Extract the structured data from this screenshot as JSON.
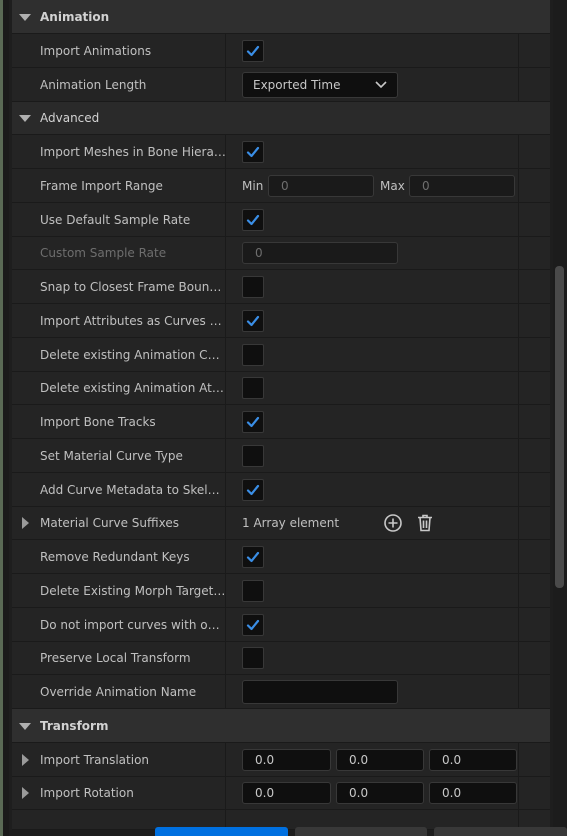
{
  "sections": {
    "animation": "Animation",
    "advanced": "Advanced",
    "transform": "Transform"
  },
  "rows": {
    "import_animations": "Import Animations",
    "animation_length": "Animation Length",
    "animation_length_value": "Exported Time",
    "import_meshes_bone": "Import Meshes in Bone Hierar...",
    "frame_import_range": "Frame Import Range",
    "min_label": "Min",
    "min_value": "0",
    "max_label": "Max",
    "max_value": "0",
    "use_default_sample_rate": "Use Default Sample Rate",
    "custom_sample_rate": "Custom Sample Rate",
    "custom_sample_rate_value": "0",
    "snap_closest_frame": "Snap to Closest Frame Boundary",
    "import_attributes_curves": "Import Attributes as Curves or...",
    "delete_existing_anim_curves": "Delete existing Animation Curv...",
    "delete_existing_anim_attrs": "Delete existing Animation Attri...",
    "import_bone_tracks": "Import Bone Tracks",
    "set_material_curve_type": "Set Material Curve Type",
    "add_curve_metadata": "Add Curve Metadata to Skeleton",
    "material_curve_suffixes": "Material Curve Suffixes",
    "material_curve_suffixes_value": "1 Array element",
    "remove_redundant_keys": "Remove Redundant Keys",
    "delete_existing_morph": "Delete Existing Morph Target C...",
    "do_not_import_curves": "Do not import curves with only...",
    "preserve_local_transform": "Preserve Local Transform",
    "override_animation_name": "Override Animation Name",
    "override_animation_name_value": "",
    "import_translation": "Import Translation",
    "import_translation_values": [
      "0.0",
      "0.0",
      "0.0"
    ],
    "import_rotation": "Import Rotation",
    "import_rotation_values": [
      "0.0",
      "0.0",
      "0.0"
    ]
  },
  "checked": {
    "import_animations": true,
    "import_meshes_bone": true,
    "use_default_sample_rate": true,
    "snap_closest_frame": false,
    "import_attributes_curves": true,
    "delete_existing_anim_curves": false,
    "delete_existing_anim_attrs": false,
    "import_bone_tracks": true,
    "set_material_curve_type": false,
    "add_curve_metadata": true,
    "remove_redundant_keys": true,
    "delete_existing_morph": false,
    "do_not_import_curves": true,
    "preserve_local_transform": false
  },
  "colors": {
    "accent": "#0070e0",
    "check": "#3a8ee6",
    "panel": "#242424",
    "section": "#2f2f2f"
  },
  "icons": {
    "add": "plus-circle-icon",
    "delete": "trash-icon",
    "dropdown": "chevron-down-icon"
  }
}
